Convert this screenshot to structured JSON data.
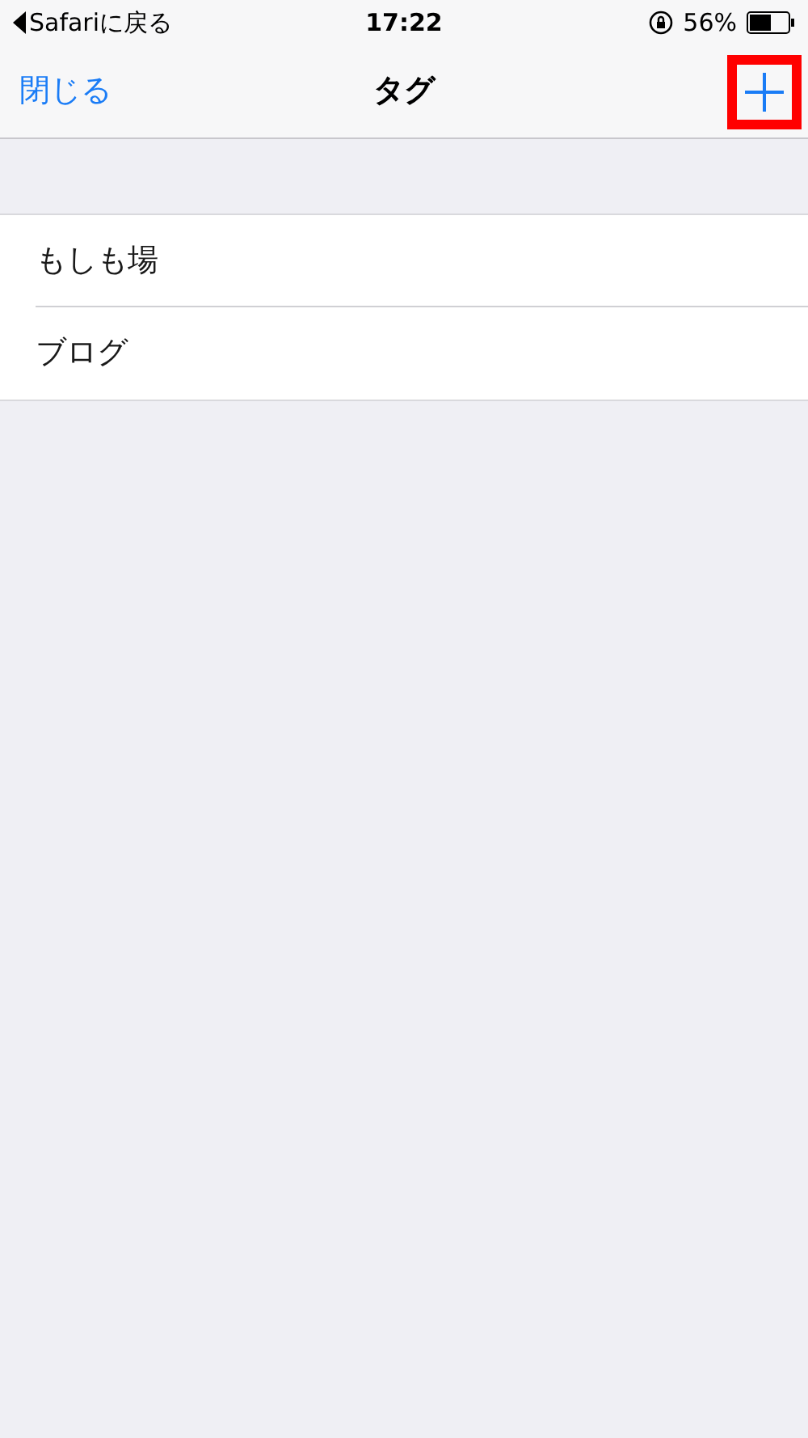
{
  "status_bar": {
    "back_label": "Safariに戻る",
    "time": "17:22",
    "battery": "56%"
  },
  "nav_bar": {
    "close": "閉じる",
    "title": "タグ",
    "add_button": {
      "highlighted": true
    }
  },
  "tags": [
    {
      "label": "もしも場"
    },
    {
      "label": "ブログ"
    }
  ]
}
